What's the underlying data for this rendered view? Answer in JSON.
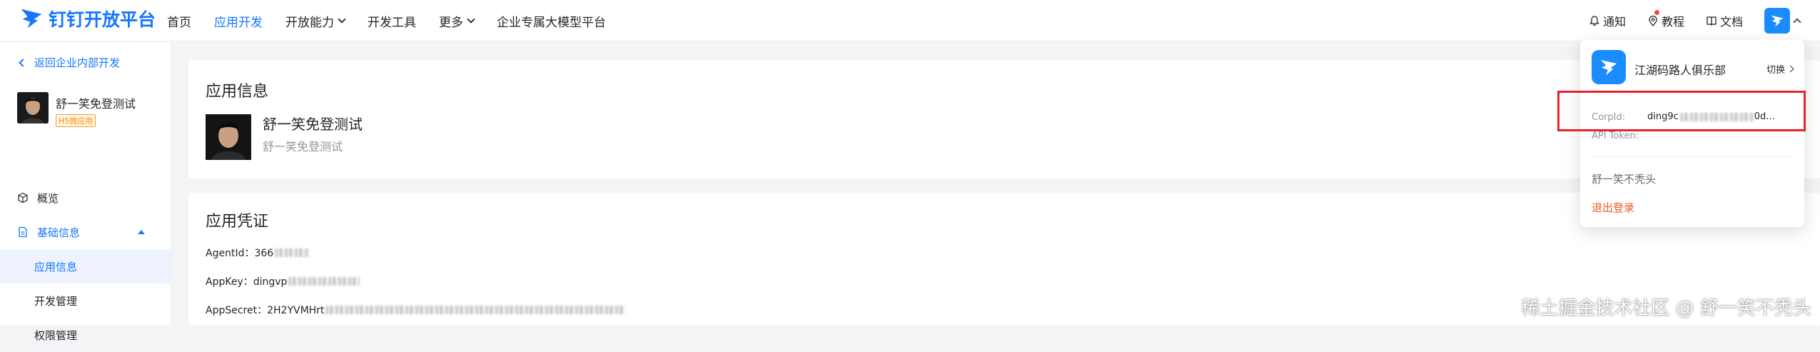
{
  "header": {
    "logo_text": "钉钉开放平台",
    "nav": [
      {
        "label": "首页"
      },
      {
        "label": "应用开发"
      },
      {
        "label": "开放能力"
      },
      {
        "label": "开发工具"
      },
      {
        "label": "更多"
      },
      {
        "label": "企业专属大模型平台"
      }
    ],
    "right": {
      "notify": "通知",
      "tutorial": "教程",
      "docs": "文档"
    }
  },
  "sidebar": {
    "back": "返回企业内部开发",
    "app_name": "舒一笑免登测试",
    "app_tag": "H5微应用",
    "items": [
      {
        "label": "概览"
      },
      {
        "label": "基础信息"
      },
      {
        "label": "应用信息"
      },
      {
        "label": "开发管理"
      },
      {
        "label": "权限管理"
      }
    ]
  },
  "app_info": {
    "title": "应用信息",
    "name": "舒一笑免登测试",
    "sub": "舒一笑免登测试"
  },
  "credentials": {
    "title": "应用凭证",
    "agent_id": "AgentId：366",
    "app_key": "AppKey：dingvp",
    "app_secret": "AppSecret：2H2YVMHrt"
  },
  "popover": {
    "org": "江湖码路人俱乐部",
    "switch": "切换",
    "corpid_label": "CorpId:",
    "corpid_prefix": "ding9c",
    "corpid_suffix": "0d...",
    "api_token_label": "API Token:",
    "user": "舒一笑不秃头",
    "logout": "退出登录"
  },
  "watermark": "稀土掘金技术社区 @ 舒一笑不秃头",
  "colors": {
    "accent": "#1677ff",
    "logout": "#f05a24",
    "highlight_box": "#e8212b"
  }
}
